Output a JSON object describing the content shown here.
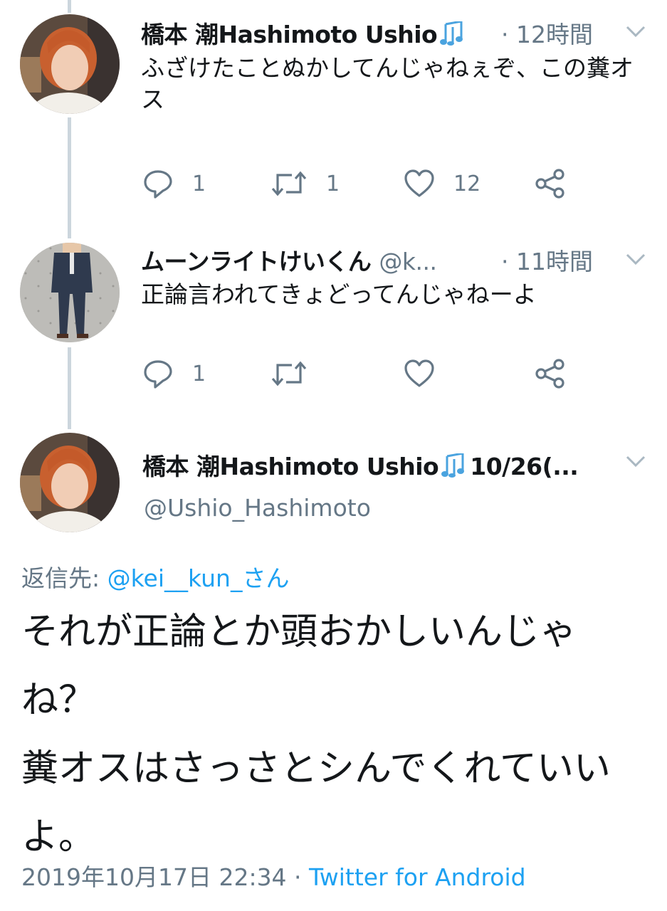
{
  "tweets": [
    {
      "name": "橋本 潮Hashimoto Ushio",
      "time": "· 12時間",
      "text": "ふざけたことぬかしてんじゃねぇぞ、この糞オス",
      "replies": "1",
      "retweets": "1",
      "likes": "12"
    },
    {
      "name": "ムーンライトけいくん",
      "handle": "@k...",
      "time": "· 11時間",
      "text": "正論言われてきょどってんじゃねーよ",
      "replies": "1",
      "retweets": "",
      "likes": ""
    }
  ],
  "main_tweet": {
    "name": "橋本 潮Hashimoto Ushio",
    "date_truncated": "10/26(...",
    "handle": "@Ushio_Hashimoto",
    "reply_to_label": "返信先:",
    "reply_to_mention": "@kei__kun_さん",
    "text_line1": "それが正論とか頭おかしいんじゃね？",
    "text_line2": "糞オスはさっさとシんでくれていいよ。",
    "timestamp": "2019年10月17日 22:34",
    "separator": " · ",
    "source": "Twitter for Android"
  },
  "icons": {
    "verified_note": "music-note-icon",
    "reply": "reply-icon",
    "retweet": "retweet-icon",
    "like": "heart-icon",
    "share": "share-icon",
    "more": "chevron-down-icon"
  },
  "colors": {
    "accent": "#1da1f2",
    "secondary_text": "#657786",
    "thread_line": "#ccd6dd"
  }
}
